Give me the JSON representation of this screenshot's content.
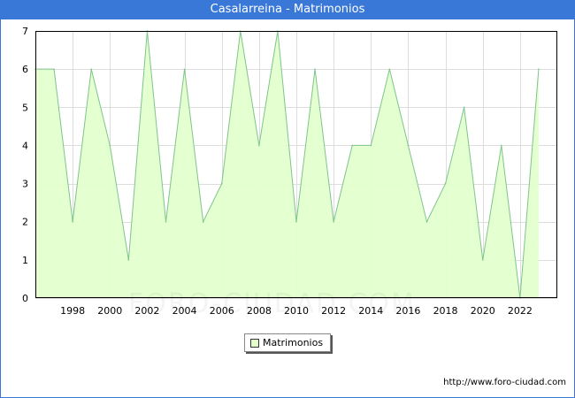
{
  "header": {
    "title": "Casalarreina - Matrimonios"
  },
  "chart_data": {
    "type": "area",
    "x": [
      1996,
      1997,
      1998,
      1999,
      2000,
      2001,
      2002,
      2003,
      2004,
      2005,
      2006,
      2007,
      2008,
      2009,
      2010,
      2011,
      2012,
      2013,
      2014,
      2015,
      2016,
      2017,
      2018,
      2019,
      2020,
      2021,
      2022,
      2023
    ],
    "series": [
      {
        "name": "Matrimonios",
        "values": [
          6,
          6,
          2,
          6,
          4,
          1,
          7,
          2,
          6,
          2,
          3,
          7,
          4,
          7,
          2,
          6,
          2,
          4,
          4,
          6,
          4,
          2,
          3,
          5,
          1,
          4,
          0,
          6
        ]
      }
    ],
    "x_ticks": [
      "1998",
      "2000",
      "2002",
      "2004",
      "2006",
      "2008",
      "2010",
      "2012",
      "2014",
      "2016",
      "2018",
      "2020",
      "2022"
    ],
    "y_ticks": [
      "0",
      "1",
      "2",
      "3",
      "4",
      "5",
      "6",
      "7"
    ],
    "ylim": [
      0,
      7
    ],
    "grid": true,
    "legend_position": "bottom-center"
  },
  "colors": {
    "fill": "#e2ffcc",
    "line": "#7ec48c",
    "grid": "#dddddd",
    "header": "#3a78d8"
  },
  "watermark": "FORO-CIUDAD.COM",
  "footer": {
    "source": "http://www.foro-ciudad.com"
  }
}
